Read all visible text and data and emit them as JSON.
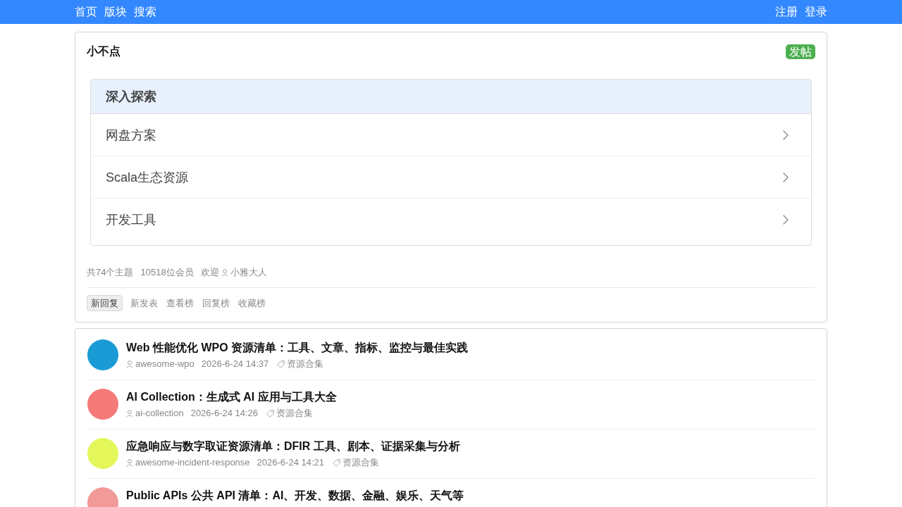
{
  "nav": {
    "left": [
      {
        "label": "首页"
      },
      {
        "label": "版块"
      },
      {
        "label": "搜索"
      }
    ],
    "right": [
      {
        "label": "注册"
      },
      {
        "label": "登录"
      }
    ]
  },
  "forum": {
    "title": "小不点",
    "post_button": "发帖",
    "explore": {
      "heading": "深入探索",
      "items": [
        {
          "label": "网盘方案"
        },
        {
          "label": "Scala生态资源"
        },
        {
          "label": "开发工具"
        }
      ]
    },
    "stats": {
      "topics": "共74个主题",
      "members": "10518位会员",
      "welcome": "欢迎",
      "user": "小雅大人"
    },
    "tabs": [
      {
        "label": "新回复",
        "selected": true
      },
      {
        "label": "新发表",
        "selected": false
      },
      {
        "label": "查看榜",
        "selected": false
      },
      {
        "label": "回复榜",
        "selected": false
      },
      {
        "label": "收藏榜",
        "selected": false
      }
    ]
  },
  "topics": [
    {
      "title": "Web 性能优化 WPO 资源清单：工具、文章、指标、监控与最佳实践",
      "author": "awesome-wpo",
      "time": "2026-6-24 14:37",
      "tag": "资源合集",
      "color": "#1a9bd5"
    },
    {
      "title": "AI Collection：生成式 AI 应用与工具大全",
      "author": "ai-collection",
      "time": "2026-6-24 14:26",
      "tag": "资源合集",
      "color": "#f47a78"
    },
    {
      "title": "应急响应与数字取证资源清单：DFIR 工具、剧本、证据采集与分析",
      "author": "awesome-incident-response",
      "time": "2026-6-24 14:21",
      "tag": "资源合集",
      "color": "#e4f75a"
    },
    {
      "title": "Public APIs 公共 API 清单：AI、开发、数据、金融、娱乐、天气等",
      "color": "#f29a98"
    }
  ]
}
